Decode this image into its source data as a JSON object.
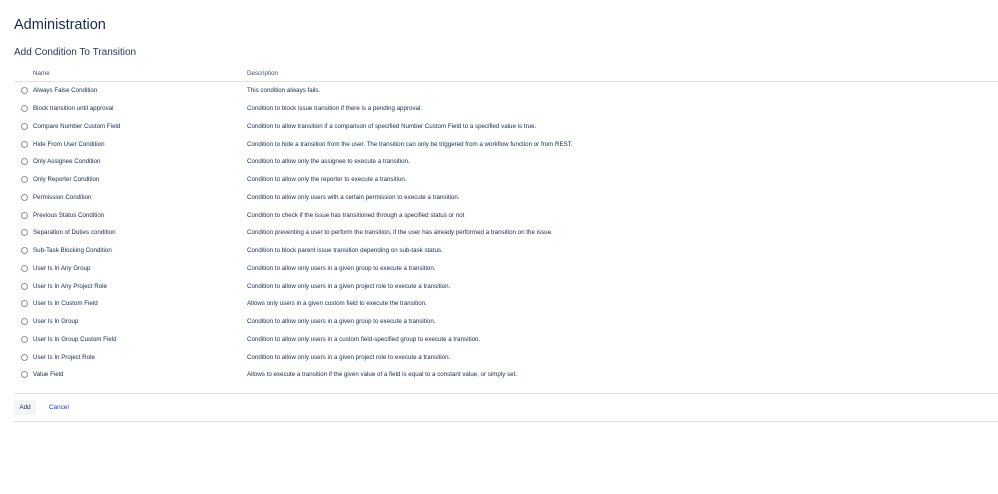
{
  "page": {
    "title": "Administration",
    "section_title": "Add Condition To Transition"
  },
  "table": {
    "headers": {
      "name": "Name",
      "description": "Description"
    },
    "rows": [
      {
        "name": "Always False Condition",
        "description": "This condition always fails."
      },
      {
        "name": "Block transition until approval",
        "description": "Condition to block issue transition if there is a pending approval."
      },
      {
        "name": "Compare Number Custom Field",
        "description": "Condition to allow transition if a comparison of specified Number Custom Field to a specified value is true."
      },
      {
        "name": "Hide From User Condition",
        "description": "Condition to hide a transition from the user. The transition can only be triggered from a workflow function or from REST."
      },
      {
        "name": "Only Assignee Condition",
        "description": "Condition to allow only the assignee to execute a transition."
      },
      {
        "name": "Only Reporter Condition",
        "description": "Condition to allow only the reporter to execute a transition."
      },
      {
        "name": "Permission Condition",
        "description": "Condition to allow only users with a certain permission to execute a transition."
      },
      {
        "name": "Previous Status Condition",
        "description": "Condition to check if the issue has transitioned through a specified status or not"
      },
      {
        "name": "Separation of Duties condition",
        "description": "Condition preventing a user to perform the transition, if the user has already performed a transition on the issue."
      },
      {
        "name": "Sub-Task Blocking Condition",
        "description": "Condition to block parent issue transition depending on sub-task status."
      },
      {
        "name": "User Is In Any Group",
        "description": "Condition to allow only users in a given group to execute a transition."
      },
      {
        "name": "User Is In Any Project Role",
        "description": "Condition to allow only users in a given project role to execute a transition."
      },
      {
        "name": "User Is In Custom Field",
        "description": "Allows only users in a given custom field to execute the transition."
      },
      {
        "name": "User Is In Group",
        "description": "Condition to allow only users in a given group to execute a transition."
      },
      {
        "name": "User Is In Group Custom Field",
        "description": "Condition to allow only users in a custom field-specified group to execute a transition."
      },
      {
        "name": "User Is In Project Role",
        "description": "Condition to allow only users in a given project role to execute a transition."
      },
      {
        "name": "Value Field",
        "description": "Allows to execute a transition if the given value of a field is equal to a constant value, or simply set."
      }
    ]
  },
  "actions": {
    "add_label": "Add",
    "cancel_label": "Cancel"
  },
  "colors": {
    "text": "#172b4d",
    "link": "#0052cc",
    "border": "#dfe1e6",
    "button_bg": "#f4f5f7"
  }
}
